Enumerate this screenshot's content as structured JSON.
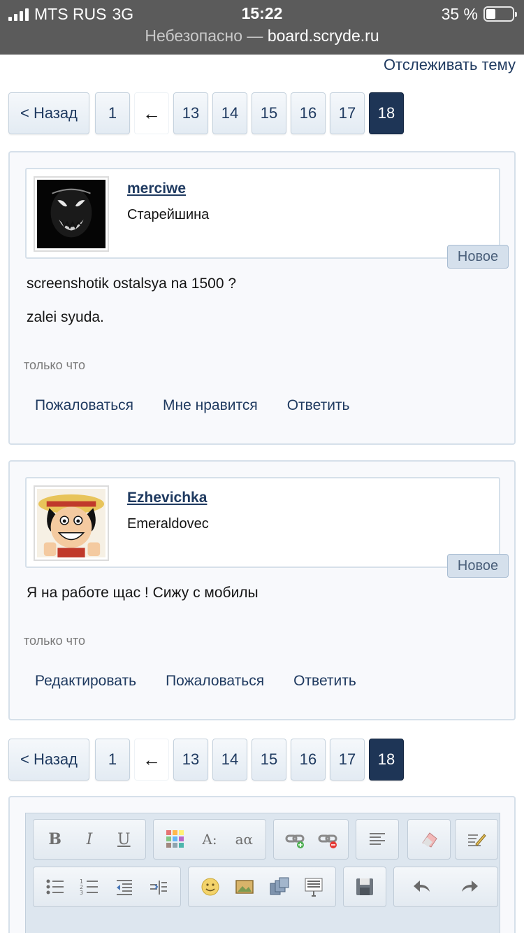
{
  "status_bar": {
    "carrier": "MTS RUS",
    "network": "3G",
    "time": "15:22",
    "battery": "35 %",
    "battery_level": 0.35
  },
  "address_bar": {
    "insecure_label": "Небезопасно —",
    "domain": "board.scryde.ru"
  },
  "follow_topic": "Отслеживать тему",
  "pagination": {
    "back": "< Назад",
    "first": "1",
    "gap": "←",
    "pages": [
      "13",
      "14",
      "15",
      "16",
      "17"
    ],
    "current": "18"
  },
  "posts": [
    {
      "username": "merciwe",
      "user_title": "Старейшина",
      "badge": "Новое",
      "message": [
        "screenshotik ostalsya na 1500 ?",
        "zalei syuda."
      ],
      "time": "только что",
      "actions": [
        "Пожаловаться",
        "Мне нравится",
        "Ответить"
      ]
    },
    {
      "username": "Ezhevichka",
      "user_title": "Emeraldovec",
      "badge": "Новое",
      "message": [
        "Я на работе щас ! Сижу с мобилы"
      ],
      "time": "только что",
      "actions": [
        "Редактировать",
        "Пожаловаться",
        "Ответить"
      ]
    }
  ],
  "editor": {
    "row1_icons": [
      "bold-icon",
      "italic-icon",
      "underline-icon",
      "color-icon",
      "font-size-icon",
      "font-family-icon",
      "link-icon",
      "unlink-icon",
      "align-icon",
      "eraser-icon",
      "pencil-icon"
    ],
    "row2_icons": [
      "bullet-list-icon",
      "numbered-list-icon",
      "outdent-icon",
      "indent-icon",
      "smiley-icon",
      "image-icon",
      "media-icon",
      "quote-icon",
      "save-icon",
      "undo-icon",
      "redo-icon"
    ],
    "bold": "B",
    "italic": "I",
    "underline": "U",
    "font_size": "A:",
    "font_family": "aα"
  }
}
